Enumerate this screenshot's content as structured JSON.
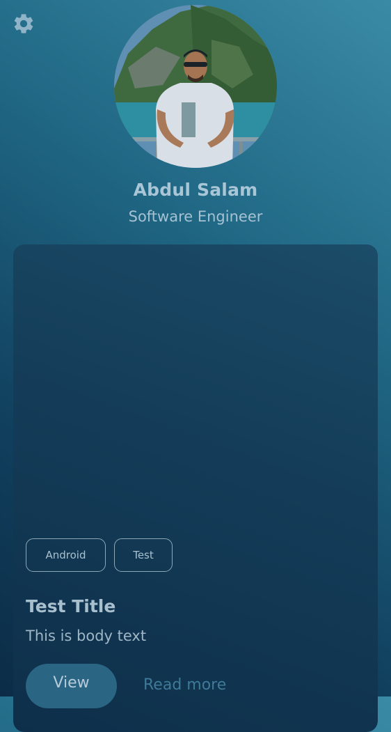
{
  "profile": {
    "name": "Abdul Salam",
    "role": "Software Engineer"
  },
  "header": {
    "settings_icon": "gear-icon"
  },
  "card": {
    "tags": [
      "Android",
      "Test"
    ],
    "title": "Test Title",
    "body": "This is body text",
    "primary_action": "View",
    "secondary_action": "Read more"
  },
  "colors": {
    "background_top": "#3a8aa6",
    "background_bottom": "#0c2c46",
    "card": "#143d59",
    "primary_button": "#2a6584",
    "link": "#3f7a99"
  }
}
